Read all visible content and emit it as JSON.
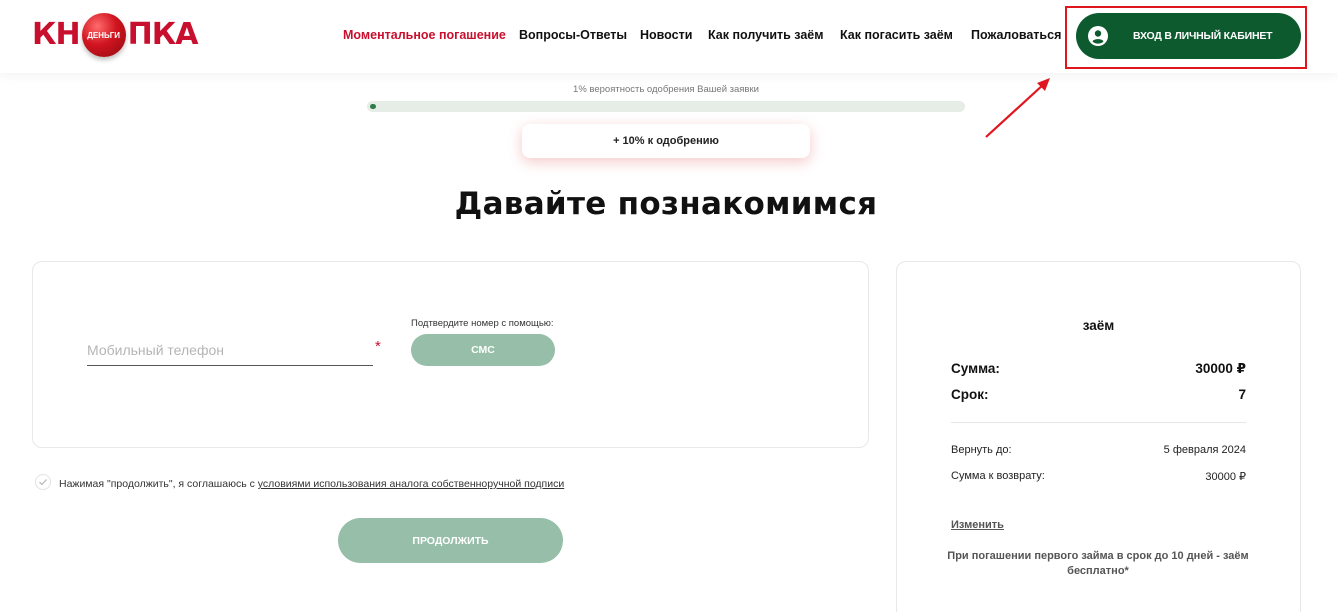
{
  "header": {
    "logo": {
      "left": "КН",
      "ball": "ДЕНЬГИ",
      "right": "ПКА"
    },
    "nav": [
      {
        "label": "Моментальное погашение",
        "active": true
      },
      {
        "label": "Вопросы-Ответы",
        "active": false
      },
      {
        "label": "Новости",
        "active": false
      },
      {
        "label": "Как получить заём",
        "active": false
      },
      {
        "label": "Как погасить заём",
        "active": false
      },
      {
        "label": "Пожаловаться",
        "active": false
      }
    ],
    "login_label": "ВХОД В ЛИЧНЫЙ КАБИНЕТ",
    "login_icon": "user-circle-icon"
  },
  "progress": {
    "caption": "1% вероятность одобрения Вашей заявки",
    "percent": 1,
    "bonus": "+ 10% к одобрению"
  },
  "page_title": "Давайте познакомимся",
  "form": {
    "phone_placeholder": "Мобильный телефон",
    "required_mark": "*",
    "confirm_label": "Подтвердите номер с помощью:",
    "sms_label": "СМС",
    "agree_text": "Нажимая \"продолжить\", я соглашаюсь с ",
    "agree_link": "условиями использования аналога собственноручной подписи",
    "continue_label": "ПРОДОЛЖИТЬ"
  },
  "summary": {
    "title": "заём",
    "amount_label": "Сумма:",
    "amount_value": "30000 ₽",
    "term_label": "Срок:",
    "term_value": "7",
    "return_by_label": "Вернуть до:",
    "return_by_value": "5 февраля 2024",
    "return_sum_label": "Сумма к возврату:",
    "return_sum_value": "30000 ₽",
    "change_link": "Изменить",
    "promo": "При погашении первого займа в срок до 10 дней - заём бесплатно*"
  },
  "colors": {
    "brand_red": "#c8102e",
    "brand_green": "#0c5a2e",
    "button_disabled": "#96bea8",
    "highlight_frame": "#e0161f"
  }
}
